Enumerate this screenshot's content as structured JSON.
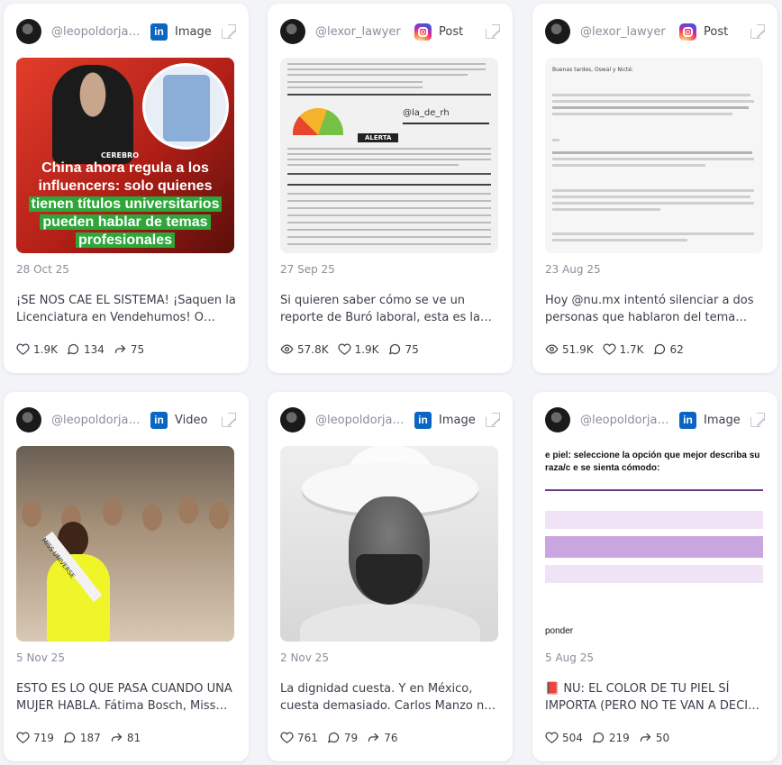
{
  "cards": [
    {
      "handle": "@leopoldorjac…",
      "platform": "LinkedIn",
      "type": "Image",
      "thumb_text": {
        "brand": "CEREBRO",
        "headline_line1": "China ahora regula a los",
        "headline_line2": "influencers: solo quienes",
        "headline_line3": "tienen títulos universitarios",
        "headline_line4": "pueden hablar de temas",
        "headline_line5": "profesionales"
      },
      "date": "28 Oct 25",
      "caption": "¡SE NOS CAE EL SISTEMA! ¡Saquen la Licenciatura en Vendehumos! O mínimo…",
      "stats": {
        "likes": "1.9K",
        "comments": "134",
        "shares": "75"
      }
    },
    {
      "handle": "@lexor_lawyer",
      "platform": "Instagram",
      "type": "Post",
      "thumb_text": {
        "watermark": "@la_de_rh",
        "alert": "ALERTA"
      },
      "date": "27 Sep 25",
      "caption": "Si quieren saber cómo se ve un reporte de Buró laboral, esta es la respuesta. Un…",
      "stats": {
        "views": "57.8K",
        "likes": "1.9K",
        "comments": "75"
      }
    },
    {
      "handle": "@lexor_lawyer",
      "platform": "Instagram",
      "type": "Post",
      "thumb_text": {
        "greeting": "Buenas tardes, Oswal y Nicté:"
      },
      "date": "23 Aug 25",
      "caption": "Hoy @nu.mx intentó silenciar a dos personas que hablaron del tema del…",
      "stats": {
        "views": "51.9K",
        "likes": "1.7K",
        "comments": "62"
      }
    },
    {
      "handle": "@leopoldorjac…",
      "platform": "LinkedIn",
      "type": "Video",
      "thumb_text": {
        "sash": "MISS UNIVERSE"
      },
      "date": "5 Nov 25",
      "caption": "ESTO ES LO QUE PASA CUANDO UNA MUJER HABLA. Fátima Bosch, Miss México, alzó l…",
      "stats": {
        "likes": "719",
        "comments": "187",
        "shares": "81"
      }
    },
    {
      "handle": "@leopoldorjac…",
      "platform": "LinkedIn",
      "type": "Image",
      "thumb_text": {},
      "date": "2 Nov 25",
      "caption": "La dignidad cuesta. Y en México, cuesta demasiado. Carlos Manzo no era un…",
      "stats": {
        "likes": "761",
        "comments": "79",
        "shares": "76"
      }
    },
    {
      "handle": "@leopoldorjac…",
      "platform": "LinkedIn",
      "type": "Image",
      "thumb_text": {
        "question": "e piel: seleccione la opción que mejor describa su raza/c e se sienta cómodo:",
        "answer": "ponder"
      },
      "date": "5 Aug 25",
      "caption": "📕 NU: EL COLOR DE TU PIEL SÍ IMPORTA (PERO NO TE VAN A DECIR POR QUÉ) En N…",
      "stats": {
        "likes": "504",
        "comments": "219",
        "shares": "50"
      }
    }
  ],
  "colors": {
    "linkedin": "#0a66c2",
    "text_muted": "#8a8f9c",
    "text_main": "#3b3f4a",
    "survey_purple": "#c9a6e0"
  }
}
